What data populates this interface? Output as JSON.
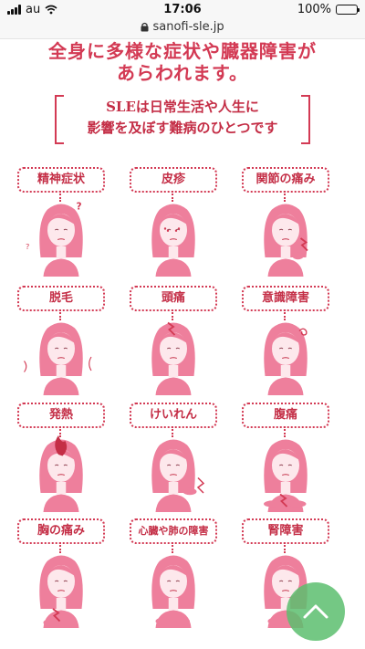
{
  "status": {
    "carrier": "au",
    "time": "17:06",
    "battery": "100%"
  },
  "browser": {
    "url": "sanofi-sle.jp"
  },
  "heading": {
    "line1": "全身に多様な症状や臓器障害が",
    "line2": "あらわれます。"
  },
  "subtext": {
    "line1": "SLEは日常生活や人生に",
    "line2": "影響を及ぼす難病のひとつです"
  },
  "symptoms": [
    {
      "label": "精神症状",
      "icon": "question-marks"
    },
    {
      "label": "皮疹",
      "icon": "cheek-rash"
    },
    {
      "label": "関節の痛み",
      "icon": "joint-pain"
    },
    {
      "label": "脱毛",
      "icon": "hair-loss"
    },
    {
      "label": "頭痛",
      "icon": "headache"
    },
    {
      "label": "意識障害",
      "icon": "swirl"
    },
    {
      "label": "発熱",
      "icon": "fever"
    },
    {
      "label": "けいれん",
      "icon": "convulsion"
    },
    {
      "label": "腹痛",
      "icon": "abdominal-pain"
    },
    {
      "label": "胸の痛み",
      "icon": "chest-pain"
    },
    {
      "label": "心臓や肺の障害",
      "icon": "heart-lung"
    },
    {
      "label": "腎障害",
      "icon": "kidney"
    }
  ],
  "colors": {
    "accent": "#d33a54",
    "hair": "#ee7f9c",
    "skin": "#fde8ec",
    "fab": "#5cbe6e"
  }
}
